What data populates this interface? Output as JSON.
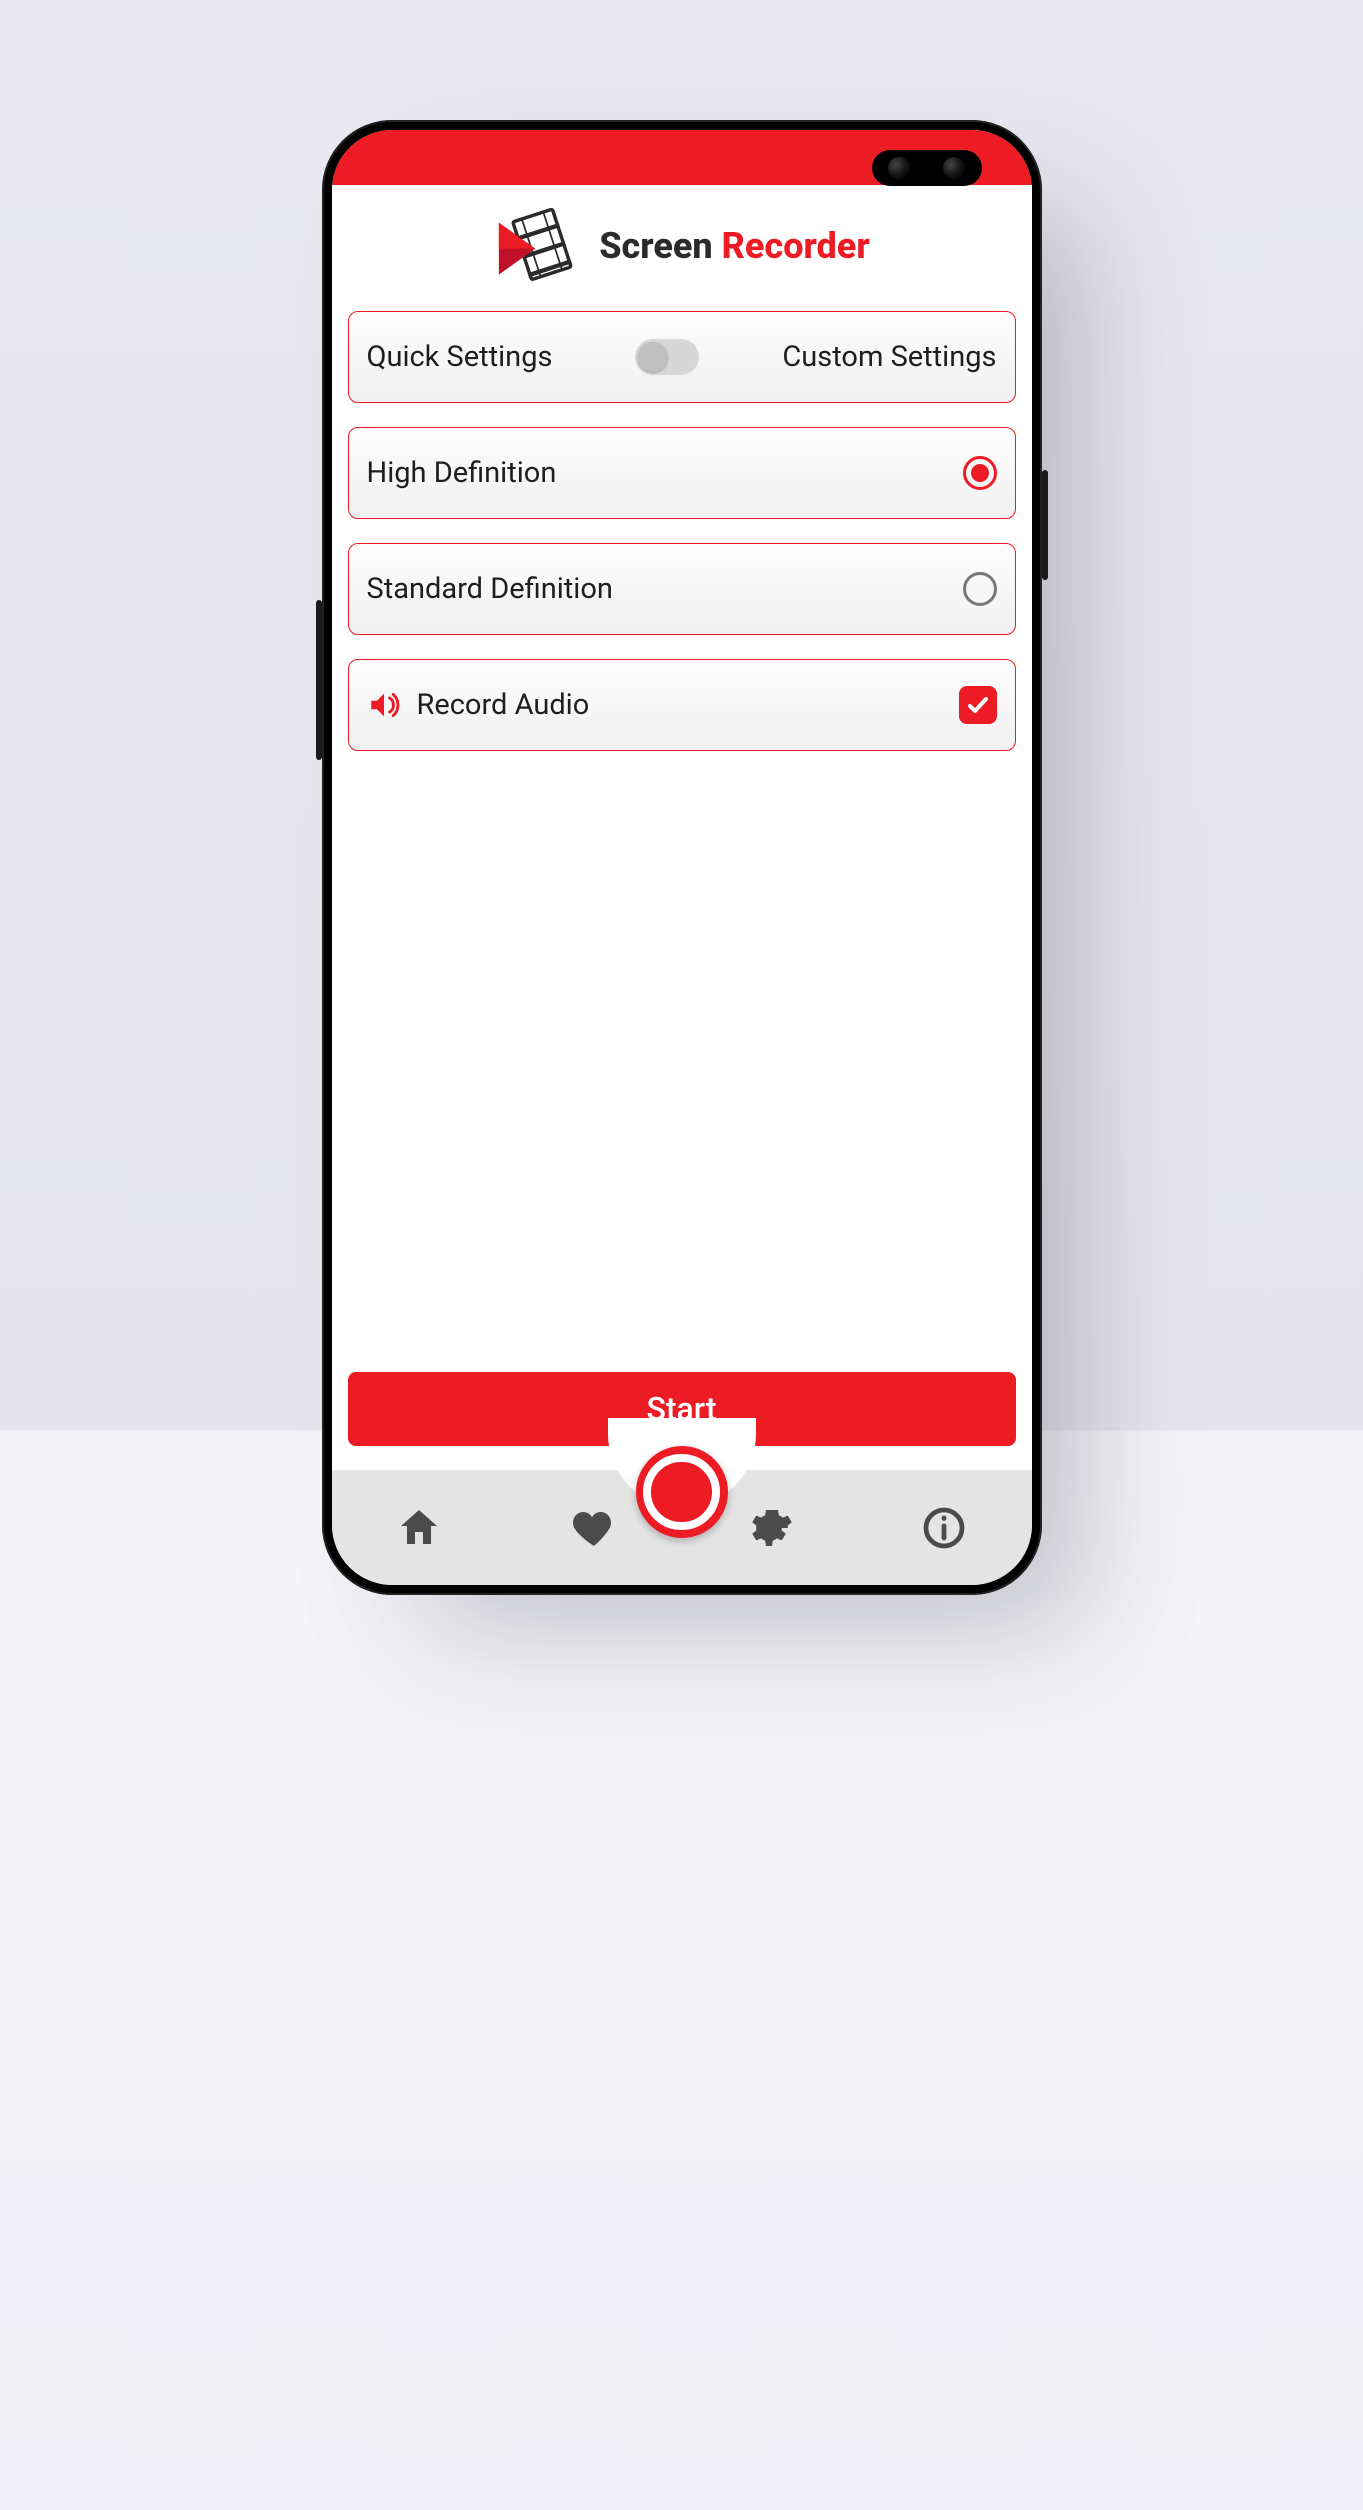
{
  "colors": {
    "accent": "#ed1c24",
    "text": "#2b2b2b",
    "muted": "#4b4b4b"
  },
  "header": {
    "title_plain": "Screen",
    "title_accent": "Recorder"
  },
  "settings_toggle": {
    "left_label": "Quick Settings",
    "right_label": "Custom Settings",
    "state": "quick"
  },
  "quality_options": [
    {
      "label": "High Definition",
      "selected": true
    },
    {
      "label": "Standard Definition",
      "selected": false
    }
  ],
  "audio": {
    "label": "Record Audio",
    "checked": true,
    "icon": "speaker-icon"
  },
  "start_button": {
    "label": "Start"
  },
  "bottom_nav": {
    "items": [
      {
        "name": "home-icon"
      },
      {
        "name": "heart-icon"
      },
      {
        "name": "record-fab"
      },
      {
        "name": "gear-icon"
      },
      {
        "name": "info-icon"
      }
    ]
  }
}
